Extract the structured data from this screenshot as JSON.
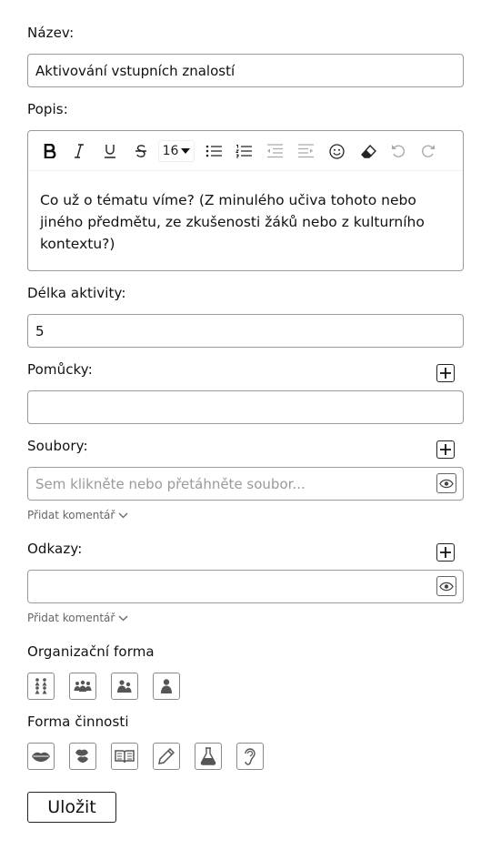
{
  "name_field": {
    "label": "Název:",
    "value": "Aktivování vstupních znalostí"
  },
  "description": {
    "label": "Popis:",
    "font_size": "16",
    "text": "Co už o tématu víme? (Z minulého učiva tohoto nebo jiného předmětu, ze zkušenosti žáků nebo z kulturního kontextu?)",
    "toolbar_icons": [
      "bold-icon",
      "italic-icon",
      "underline-icon",
      "strikethrough-icon",
      "font-size-select",
      "bullet-list-icon",
      "numbered-list-icon",
      "outdent-icon",
      "indent-icon",
      "emoji-icon",
      "eraser-icon",
      "undo-icon",
      "redo-icon"
    ]
  },
  "duration": {
    "label": "Délka aktivity:",
    "value": "5"
  },
  "tools": {
    "label": "Pomůcky:",
    "value": ""
  },
  "files": {
    "label": "Soubory:",
    "placeholder": "Sem klikněte nebo přetáhněte soubor...",
    "comment_label": "Přidat komentář"
  },
  "links": {
    "label": "Odkazy:",
    "value": "",
    "comment_label": "Přidat komentář"
  },
  "org_form": {
    "label": "Organizační forma",
    "icons": [
      "pairs-icon",
      "group-icon",
      "small-group-icon",
      "individual-icon"
    ]
  },
  "activity_form": {
    "label": "Forma činnosti",
    "icons": [
      "mouth-icon",
      "speaking-icon",
      "reading-icon",
      "writing-icon",
      "experiment-icon",
      "listening-icon"
    ]
  },
  "save_label": "Uložit",
  "colors": {
    "border": "#9a9a9a",
    "icon": "#555555",
    "text": "#111111"
  }
}
